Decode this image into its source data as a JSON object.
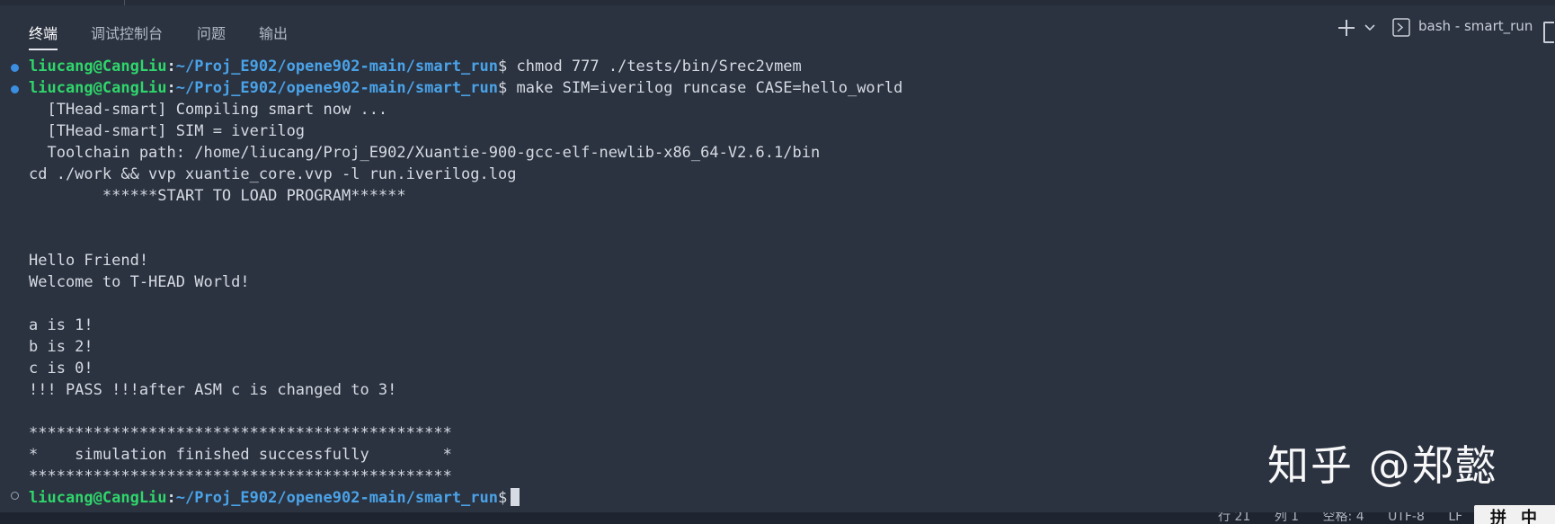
{
  "panel": {
    "tabs": [
      {
        "label": "终端",
        "active": true
      },
      {
        "label": "调试控制台",
        "active": false
      },
      {
        "label": "问题",
        "active": false
      },
      {
        "label": "输出",
        "active": false
      }
    ],
    "terminal_name": "bash - smart_run",
    "icons": [
      "plus-icon",
      "chevron-down-icon",
      "terminal-icon"
    ]
  },
  "terminal": {
    "prompt": {
      "user": "liucang@CangLiu",
      "sep": ":",
      "path": "~/Proj_E902/opene902-main/smart_run",
      "dollar": "$"
    },
    "commands": [
      " chmod 777 ./tests/bin/Srec2vmem",
      " make SIM=iverilog runcase CASE=hello_world"
    ],
    "output": [
      "  [THead-smart] Compiling smart now ...",
      "  [THead-smart] SIM = iverilog",
      "  Toolchain path: /home/liucang/Proj_E902/Xuantie-900-gcc-elf-newlib-x86_64-V2.6.1/bin",
      "cd ./work && vvp xuantie_core.vvp -l run.iverilog.log",
      "        ******START TO LOAD PROGRAM******",
      "",
      "",
      "Hello Friend!",
      "Welcome to T-HEAD World!",
      "",
      "a is 1!",
      "b is 2!",
      "c is 0!",
      "!!! PASS !!!after ASM c is changed to 3!",
      "",
      "**********************************************",
      "*    simulation finished successfully        *",
      "**********************************************"
    ]
  },
  "watermark": "知乎 @郑懿",
  "status_bar": {
    "items": [
      "行 21",
      "列 1",
      "空格: 4",
      "UTF-8",
      "LF"
    ],
    "ime": [
      "拼",
      "中"
    ]
  },
  "colors": {
    "background": "#2b3240",
    "prompt_user": "#2fd66b",
    "prompt_path": "#4aa3e8",
    "text": "#d6dbe3",
    "decoration_dot": "#3b8ee0"
  }
}
